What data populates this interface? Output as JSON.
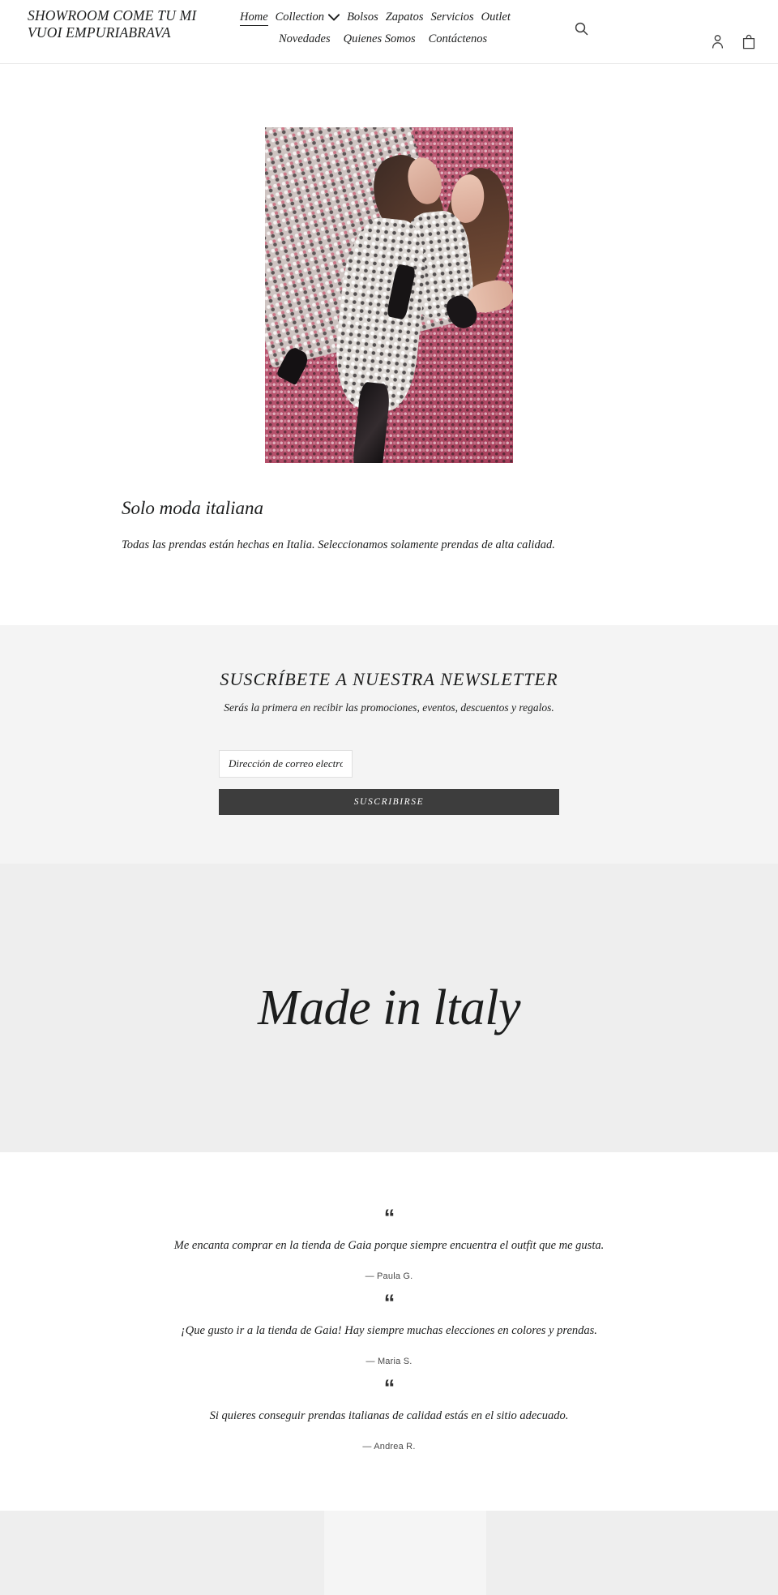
{
  "header": {
    "logo": "SHOWROOM COME TU MI VUOI EMPURIABRAVA",
    "nav_row1": [
      {
        "label": "Home",
        "active": true,
        "caret": false
      },
      {
        "label": "Collection",
        "active": false,
        "caret": true
      },
      {
        "label": "Bolsos",
        "active": false,
        "caret": false
      },
      {
        "label": "Zapatos",
        "active": false,
        "caret": false
      },
      {
        "label": "Servicios",
        "active": false,
        "caret": false
      },
      {
        "label": "Outlet",
        "active": false,
        "caret": false
      }
    ],
    "nav_row2": [
      {
        "label": "Novedades"
      },
      {
        "label": "Quienes Somos"
      },
      {
        "label": "Contáctenos"
      }
    ],
    "icons": {
      "search": "search-icon",
      "account": "account-icon",
      "cart": "shopping-bag-icon"
    }
  },
  "feature": {
    "image_alt": "two-women-in-italian-fashion-on-pink-patterned-background",
    "heading": "Solo moda italiana",
    "body": "Todas las prendas están hechas en Italia. Seleccionamos solamente prendas de alta calidad."
  },
  "newsletter": {
    "title": "SUSCRÍBETE A NUESTRA NEWSLETTER",
    "subtitle": "Serás la primera en recibir las promociones, eventos, descuentos y regalos.",
    "email_placeholder": "Dirección de correo electrónico",
    "email_value": "",
    "submit_label": "SUSCRIBIRSE"
  },
  "banner": {
    "text": "Made in ltaly"
  },
  "testimonials": {
    "quote_mark": "“",
    "items": [
      {
        "quote": "Me encanta comprar en la tienda de Gaia porque siempre encuentra el outfit que me gusta.",
        "author": "— Paula G."
      },
      {
        "quote": "¡Que gusto ir a la tienda de Gaia! Hay siempre muchas elecciones en colores y prendas.",
        "author": "— Maria S."
      },
      {
        "quote": "Si quieres conseguir prendas italianas de calidad estás en el sitio adecuado.",
        "author": "— Andrea R."
      }
    ]
  },
  "colors": {
    "text": "#1c1d1d",
    "newsletter_bg": "#f4f4f4",
    "banner_bg": "#eeeeee",
    "button_bg": "#3d3d3d",
    "footer_block_light": "#f5f5f5"
  }
}
